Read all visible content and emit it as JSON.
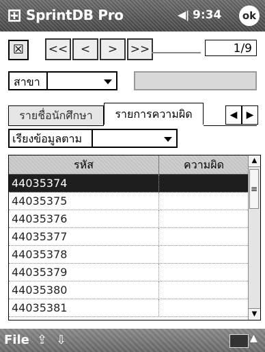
{
  "titlebar": {
    "title": "SprintDB Pro",
    "volume_icon": "◀‹",
    "time": "9:34",
    "ok_label": "ok"
  },
  "nav": {
    "close_glyph": "☒",
    "first_label": "<<",
    "prev_label": "<",
    "next_label": ">",
    "last_label": ">>",
    "page": "1/9"
  },
  "branch": {
    "label": "สาขา",
    "selected_value": ""
  },
  "tabs": [
    {
      "label": "รายชื่อนักศึกษา",
      "active": false
    },
    {
      "label": "รายการความผิด",
      "active": true
    }
  ],
  "tab_scroll": {
    "left": "◀",
    "right": "▶"
  },
  "sort": {
    "label": "เรียงข้อมูลตาม",
    "selected_value": ""
  },
  "grid": {
    "columns": [
      "รหัส",
      "ความผิด"
    ],
    "rows": [
      {
        "id": "44035374",
        "offense": "",
        "selected": true
      },
      {
        "id": "44035375",
        "offense": ""
      },
      {
        "id": "44035376",
        "offense": ""
      },
      {
        "id": "44035377",
        "offense": ""
      },
      {
        "id": "44035378",
        "offense": ""
      },
      {
        "id": "44035379",
        "offense": ""
      },
      {
        "id": "44035380",
        "offense": ""
      },
      {
        "id": "44035381",
        "offense": ""
      }
    ]
  },
  "menubar": {
    "file_label": "File"
  },
  "colors": {
    "titlebar": "#555555",
    "selected_row": "#1e1e1e",
    "header": "#cfcfcf"
  }
}
